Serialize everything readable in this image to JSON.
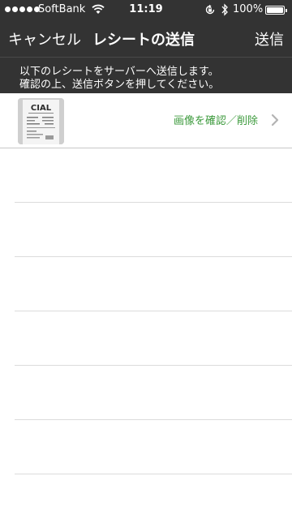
{
  "status_bar": {
    "carrier": "SoftBank",
    "time": "11:19",
    "battery": "100%"
  },
  "nav": {
    "cancel_label": "キャンセル",
    "title": "レシートの送信",
    "send_label": "送信"
  },
  "info": {
    "line1": "以下のレシートをサーバーへ送信します。",
    "line2": "確認の上、送信ボタンを押してください。"
  },
  "receipts": [
    {
      "logo_text": "CIAL",
      "action_label": "画像を確認／削除"
    }
  ],
  "colors": {
    "bar": "#333333",
    "action": "#3c9a3c",
    "separator": "#dcdcdc"
  },
  "icons": [
    "wifi-icon",
    "rotation-lock-icon",
    "bluetooth-icon",
    "battery-icon",
    "chevron-right-icon"
  ]
}
